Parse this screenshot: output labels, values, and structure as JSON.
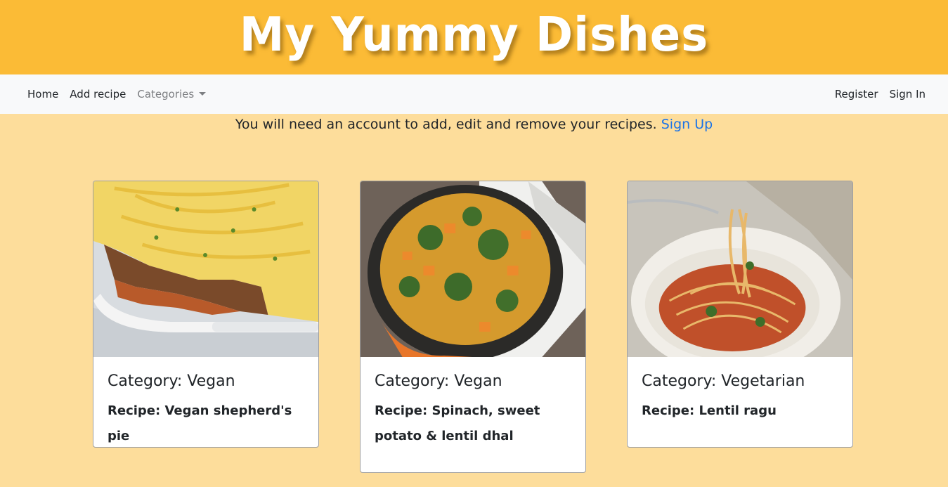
{
  "banner": {
    "title": "My Yummy Dishes"
  },
  "nav": {
    "home": "Home",
    "add_recipe": "Add recipe",
    "categories": "Categories",
    "register": "Register",
    "sign_in": "Sign In"
  },
  "notice": {
    "text": "You will need an account to add, edit and remove your recipes.",
    "link": "Sign Up"
  },
  "cards": [
    {
      "category": "Category: Vegan",
      "recipe": "Recipe: Vegan shepherd's pie",
      "image": "shepherds-pie-photo"
    },
    {
      "category": "Category: Vegan",
      "recipe": "Recipe: Spinach, sweet potato & lentil dhal",
      "image": "lentil-dhal-photo"
    },
    {
      "category": "Category: Vegetarian",
      "recipe": "Recipe: Lentil ragu",
      "image": "spaghetti-ragu-photo"
    }
  ],
  "colors": {
    "banner": "#fbbb36",
    "page": "#fddd9b",
    "link": "#1a73e8"
  }
}
